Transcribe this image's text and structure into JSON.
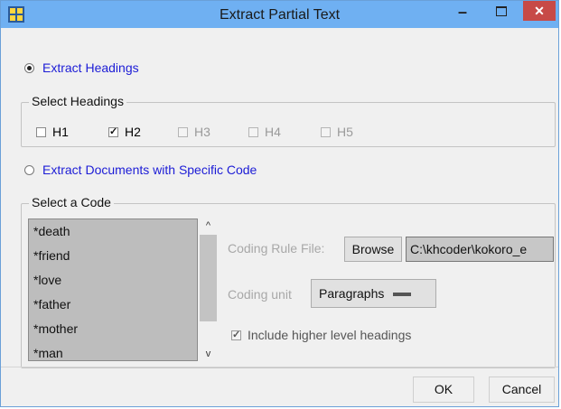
{
  "window": {
    "title": "Extract Partial Text",
    "minimize": "–",
    "close": "✕"
  },
  "extract_headings": {
    "label": "Extract Headings",
    "selected": true
  },
  "select_headings": {
    "label": "Select Headings",
    "options": [
      {
        "label": "H1",
        "checked": false,
        "enabled": true
      },
      {
        "label": "H2",
        "checked": true,
        "enabled": true
      },
      {
        "label": "H3",
        "checked": false,
        "enabled": false
      },
      {
        "label": "H4",
        "checked": false,
        "enabled": false
      },
      {
        "label": "H5",
        "checked": false,
        "enabled": false
      }
    ],
    "check_mark": "✓"
  },
  "extract_code": {
    "label": "Extract Documents with Specific Code",
    "selected": false
  },
  "select_code": {
    "label": "Select a Code",
    "codes": [
      "*death",
      "*friend",
      "*love",
      "*father",
      "*mother",
      "*man"
    ],
    "scroll_up": "^",
    "scroll_down": "v"
  },
  "coding_rule": {
    "label": "Coding Rule File:",
    "browse": "Browse",
    "path": "C:\\khcoder\\kokoro_e"
  },
  "coding_unit": {
    "label": "Coding unit",
    "value": "Paragraphs"
  },
  "include_higher": {
    "label": "Include higher level headings",
    "checked": true,
    "check_mark": "✓"
  },
  "buttons": {
    "ok": "OK",
    "cancel": "Cancel"
  },
  "colors": {
    "titlebar": "#6fb0f2",
    "close": "#c74a47",
    "link_text": "#1c1cd6",
    "list_bg": "#bdbdbd"
  },
  "icons": [
    "app-icon",
    "minimize-icon",
    "maximize-icon",
    "close-icon"
  ]
}
